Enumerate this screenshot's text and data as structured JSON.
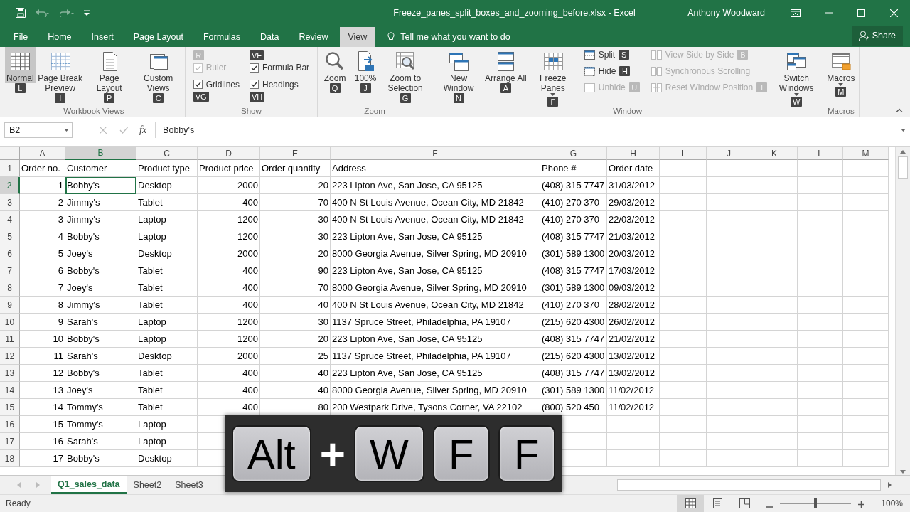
{
  "title_bar": {
    "title": "Freeze_panes_split_boxes_and_zooming_before.xlsx - Excel",
    "user": "Anthony Woodward",
    "quick_access": [
      {
        "kind": "save",
        "disabled": false
      },
      {
        "kind": "undo",
        "disabled": true
      },
      {
        "kind": "redo",
        "disabled": true
      },
      {
        "kind": "customize",
        "disabled": false
      }
    ]
  },
  "ribbon_tabs": [
    {
      "label": "File",
      "selected": false
    },
    {
      "label": "Home",
      "selected": false
    },
    {
      "label": "Insert",
      "selected": false
    },
    {
      "label": "Page Layout",
      "selected": false
    },
    {
      "label": "Formulas",
      "selected": false
    },
    {
      "label": "Data",
      "selected": false
    },
    {
      "label": "Review",
      "selected": false
    },
    {
      "label": "View",
      "selected": true
    }
  ],
  "tell_me": {
    "placeholder": "Tell me what you want to do"
  },
  "share_button": "Share",
  "ribbon": {
    "groups": [
      {
        "label": "Workbook Views",
        "items": [
          {
            "kind": "large",
            "label": "Normal",
            "keytip": "L",
            "selected": true
          },
          {
            "kind": "large",
            "label": "Page Break Preview",
            "keytip": "I",
            "selected": false
          },
          {
            "kind": "large",
            "label": "Page Layout",
            "keytip": "P",
            "selected": false
          },
          {
            "kind": "large",
            "label": "Custom Views",
            "keytip": "C",
            "selected": false
          }
        ]
      },
      {
        "label": "Show",
        "items": [
          {
            "kind": "check",
            "label": "Ruler",
            "keytip": "R",
            "checked": true,
            "disabled": true
          },
          {
            "kind": "check",
            "label": "Formula Bar",
            "keytip": "VF",
            "checked": true,
            "disabled": false
          },
          {
            "kind": "check",
            "label": "Gridlines",
            "keytip": "VG",
            "checked": true,
            "disabled": false
          },
          {
            "kind": "check",
            "label": "Headings",
            "keytip": "VH",
            "checked": true,
            "disabled": false
          }
        ]
      },
      {
        "label": "Zoom",
        "items": [
          {
            "kind": "large",
            "label": "Zoom",
            "keytip": "Q"
          },
          {
            "kind": "large",
            "label": "100%",
            "keytip": "J"
          },
          {
            "kind": "large",
            "label": "Zoom to Selection",
            "keytip": "G"
          }
        ]
      },
      {
        "label": "Window",
        "items": [
          {
            "kind": "large",
            "label": "New Window",
            "keytip": "N"
          },
          {
            "kind": "large",
            "label": "Arrange All",
            "keytip": "A"
          },
          {
            "kind": "large",
            "label": "Freeze Panes",
            "keytip": "F",
            "dropdown": true
          },
          {
            "kind": "stack",
            "items": [
              {
                "kind": "small",
                "label": "Split",
                "keytip": "S",
                "disabled": false
              },
              {
                "kind": "small",
                "label": "Hide",
                "keytip": "H",
                "disabled": false
              },
              {
                "kind": "small",
                "label": "Unhide",
                "keytip": "U",
                "disabled": true
              }
            ]
          },
          {
            "kind": "stack",
            "items": [
              {
                "kind": "small",
                "label": "View Side by Side",
                "keytip": "B",
                "disabled": true
              },
              {
                "kind": "small",
                "label": "Synchronous Scrolling",
                "disabled": true
              },
              {
                "kind": "small",
                "label": "Reset Window Position",
                "keytip": "T",
                "disabled": true
              }
            ]
          },
          {
            "kind": "large",
            "label": "Switch Windows",
            "keytip": "W",
            "dropdown": true
          }
        ]
      },
      {
        "label": "Macros",
        "items": [
          {
            "kind": "large",
            "label": "Macros",
            "keytip": "M",
            "dropdown": true
          }
        ]
      }
    ]
  },
  "formula_bar": {
    "name_box": "B2",
    "function_label": "fx",
    "formula": "Bobby's"
  },
  "sheet": {
    "columns": [
      {
        "label": "A",
        "selected": false,
        "numeric": true
      },
      {
        "label": "B",
        "selected": true
      },
      {
        "label": "C",
        "selected": false
      },
      {
        "label": "D",
        "selected": false,
        "numeric": true
      },
      {
        "label": "E",
        "selected": false,
        "numeric": true
      },
      {
        "label": "F",
        "selected": false
      },
      {
        "label": "G",
        "selected": false
      },
      {
        "label": "H",
        "selected": false
      },
      {
        "label": "I",
        "selected": false
      },
      {
        "label": "J",
        "selected": false
      },
      {
        "label": "K",
        "selected": false
      },
      {
        "label": "L",
        "selected": false
      },
      {
        "label": "M",
        "selected": false
      }
    ],
    "rows": [
      {
        "header": "1",
        "selected": false,
        "kind": "heading",
        "cells": [
          "Order no.",
          "Customer",
          "Product type",
          "Product price",
          "Order quantity",
          "Address",
          "Phone #",
          "Order date"
        ]
      },
      {
        "header": "2",
        "selected": true,
        "kind": "data",
        "cells": [
          "1",
          "Bobby's",
          "Desktop",
          "2000",
          "20",
          "223 Lipton Ave, San Jose, CA 95125",
          "(408) 315 7747",
          "31/03/2012"
        ]
      },
      {
        "header": "3",
        "selected": false,
        "kind": "data",
        "cells": [
          "2",
          "Jimmy's",
          "Tablet",
          "400",
          "70",
          "400 N St Louis Avenue, Ocean City, MD 21842",
          "(410) 270 370",
          "29/03/2012"
        ]
      },
      {
        "header": "4",
        "selected": false,
        "kind": "data",
        "cells": [
          "3",
          "Jimmy's",
          "Laptop",
          "1200",
          "30",
          "400 N St Louis Avenue, Ocean City, MD 21842",
          "(410) 270 370",
          "22/03/2012"
        ]
      },
      {
        "header": "5",
        "selected": false,
        "kind": "data",
        "cells": [
          "4",
          "Bobby's",
          "Laptop",
          "1200",
          "30",
          "223 Lipton Ave, San Jose, CA 95125",
          "(408) 315 7747",
          "21/03/2012"
        ]
      },
      {
        "header": "6",
        "selected": false,
        "kind": "data",
        "cells": [
          "5",
          "Joey's",
          "Desktop",
          "2000",
          "20",
          "8000 Georgia Avenue, Silver Spring, MD 20910",
          "(301) 589 1300",
          "20/03/2012"
        ]
      },
      {
        "header": "7",
        "selected": false,
        "kind": "data",
        "cells": [
          "6",
          "Bobby's",
          "Tablet",
          "400",
          "90",
          "223 Lipton Ave, San Jose, CA 95125",
          "(408) 315 7747",
          "17/03/2012"
        ]
      },
      {
        "header": "8",
        "selected": false,
        "kind": "data",
        "cells": [
          "7",
          "Joey's",
          "Tablet",
          "400",
          "70",
          "8000 Georgia Avenue, Silver Spring, MD 20910",
          "(301) 589 1300",
          "09/03/2012"
        ]
      },
      {
        "header": "9",
        "selected": false,
        "kind": "data",
        "cells": [
          "8",
          "Jimmy's",
          "Tablet",
          "400",
          "40",
          "400 N St Louis Avenue, Ocean City, MD 21842",
          "(410) 270 370",
          "28/02/2012"
        ]
      },
      {
        "header": "10",
        "selected": false,
        "kind": "data",
        "cells": [
          "9",
          "Sarah's",
          "Laptop",
          "1200",
          "30",
          "1137 Spruce Street, Philadelphia, PA 19107",
          "(215) 620 4300",
          "26/02/2012"
        ]
      },
      {
        "header": "11",
        "selected": false,
        "kind": "data",
        "cells": [
          "10",
          "Bobby's",
          "Laptop",
          "1200",
          "20",
          "223 Lipton Ave, San Jose, CA 95125",
          "(408) 315 7747",
          "21/02/2012"
        ]
      },
      {
        "header": "12",
        "selected": false,
        "kind": "data",
        "cells": [
          "11",
          "Sarah's",
          "Desktop",
          "2000",
          "25",
          "1137 Spruce Street, Philadelphia, PA 19107",
          "(215) 620 4300",
          "13/02/2012"
        ]
      },
      {
        "header": "13",
        "selected": false,
        "kind": "data",
        "cells": [
          "12",
          "Bobby's",
          "Tablet",
          "400",
          "40",
          "223 Lipton Ave, San Jose, CA 95125",
          "(408) 315 7747",
          "13/02/2012"
        ]
      },
      {
        "header": "14",
        "selected": false,
        "kind": "data",
        "cells": [
          "13",
          "Joey's",
          "Tablet",
          "400",
          "40",
          "8000 Georgia Avenue, Silver Spring, MD 20910",
          "(301) 589 1300",
          "11/02/2012"
        ]
      },
      {
        "header": "15",
        "selected": false,
        "kind": "data",
        "cells": [
          "14",
          "Tommy's",
          "Tablet",
          "400",
          "80",
          "200 Westpark Drive, Tysons Corner, VA 22102",
          "(800) 520 450",
          "11/02/2012"
        ]
      },
      {
        "header": "16",
        "selected": false,
        "kind": "data",
        "cells": [
          "15",
          "Tommy's",
          "Laptop"
        ]
      },
      {
        "header": "17",
        "selected": false,
        "kind": "data",
        "cells": [
          "16",
          "Sarah's",
          "Laptop"
        ]
      },
      {
        "header": "18",
        "selected": false,
        "kind": "data",
        "cells": [
          "17",
          "Bobby's",
          "Desktop"
        ]
      }
    ]
  },
  "sheet_tabs": [
    {
      "label": "Q1_sales_data",
      "selected": true
    },
    {
      "label": "Sheet2",
      "selected": false
    },
    {
      "label": "Sheet3",
      "selected": false
    }
  ],
  "key_overlay": [
    {
      "kind": "key",
      "label": "Alt"
    },
    {
      "kind": "plus",
      "label": "+"
    },
    {
      "kind": "key",
      "label": "W"
    },
    {
      "kind": "key",
      "label": "F"
    },
    {
      "kind": "key",
      "label": "F"
    }
  ],
  "status_bar": {
    "status": "Ready",
    "views": [
      {
        "kind": "normal",
        "selected": true
      },
      {
        "kind": "page-layout",
        "selected": false
      },
      {
        "kind": "page-break",
        "selected": false
      }
    ],
    "zoom": {
      "level": 0.5,
      "reading": "100%"
    }
  }
}
